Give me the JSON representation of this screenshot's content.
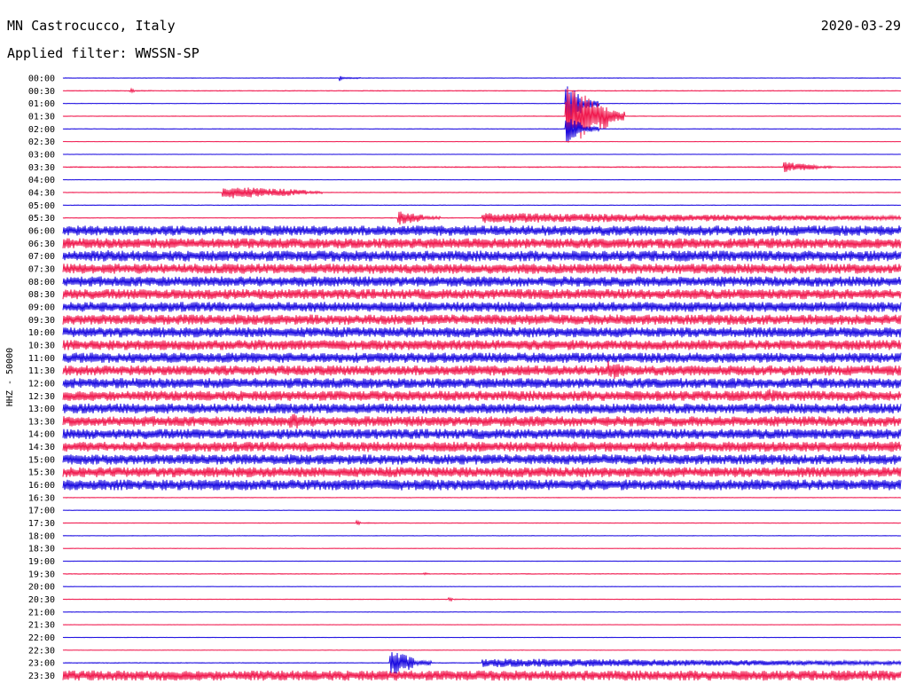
{
  "header": {
    "station": "MN Castrocucco, Italy",
    "date": "2020-03-29",
    "filter": "Applied filter: WWSSN-SP"
  },
  "chart_data": {
    "type": "line",
    "title": "MN Castrocucco, Italy",
    "ylabel": "HHZ - 50000",
    "colors": [
      "#1a0ae0",
      "#f0194e"
    ],
    "rows": [
      {
        "label": "00:00",
        "amp": 0.05,
        "events": [
          {
            "at": 0.33,
            "amp": 0.5,
            "len": 0.005
          }
        ]
      },
      {
        "label": "00:30",
        "amp": 0.06,
        "events": [
          {
            "at": 0.08,
            "amp": 0.4,
            "len": 0.005
          }
        ]
      },
      {
        "label": "01:00",
        "amp": 0.04,
        "events": [
          {
            "at": 0.6,
            "amp": 3.5,
            "len": 0.02
          }
        ]
      },
      {
        "label": "01:30",
        "amp": 0.05,
        "events": [
          {
            "at": 0.6,
            "amp": 4.5,
            "len": 0.05
          }
        ]
      },
      {
        "label": "02:00",
        "amp": 0.05,
        "events": [
          {
            "at": 0.6,
            "amp": 2.2,
            "len": 0.02
          }
        ]
      },
      {
        "label": "02:30",
        "amp": 0.03,
        "events": []
      },
      {
        "label": "03:00",
        "amp": 0.03,
        "events": []
      },
      {
        "label": "03:30",
        "amp": 0.08,
        "events": [
          {
            "at": 0.86,
            "amp": 0.8,
            "len": 0.04
          }
        ]
      },
      {
        "label": "04:00",
        "amp": 0.03,
        "events": []
      },
      {
        "label": "04:30",
        "amp": 0.05,
        "events": [
          {
            "at": 0.19,
            "amp": 1.0,
            "len": 0.1
          }
        ]
      },
      {
        "label": "05:00",
        "amp": 0.05,
        "events": []
      },
      {
        "label": "05:30",
        "amp": 0.06,
        "events": [
          {
            "at": 0.4,
            "amp": 1.2,
            "len": 0.03
          },
          {
            "at": 0.5,
            "amp": 0.8,
            "len": 0.5
          }
        ]
      },
      {
        "label": "06:00",
        "amp": 0.8,
        "events": []
      },
      {
        "label": "06:30",
        "amp": 0.8,
        "events": []
      },
      {
        "label": "07:00",
        "amp": 0.85,
        "events": [
          {
            "at": 0.05,
            "amp": 1.0,
            "len": 0.04
          }
        ]
      },
      {
        "label": "07:30",
        "amp": 0.8,
        "events": []
      },
      {
        "label": "08:00",
        "amp": 0.8,
        "events": []
      },
      {
        "label": "08:30",
        "amp": 0.8,
        "events": []
      },
      {
        "label": "09:00",
        "amp": 0.8,
        "events": []
      },
      {
        "label": "09:30",
        "amp": 0.8,
        "events": []
      },
      {
        "label": "10:00",
        "amp": 0.8,
        "events": []
      },
      {
        "label": "10:30",
        "amp": 0.8,
        "events": [
          {
            "at": 0.23,
            "amp": 1.0,
            "len": 0.03
          }
        ]
      },
      {
        "label": "11:00",
        "amp": 0.8,
        "events": []
      },
      {
        "label": "11:30",
        "amp": 0.8,
        "events": [
          {
            "at": 0.65,
            "amp": 1.6,
            "len": 0.03
          }
        ]
      },
      {
        "label": "12:00",
        "amp": 0.8,
        "events": []
      },
      {
        "label": "12:30",
        "amp": 0.8,
        "events": [
          {
            "at": 0.84,
            "amp": 1.2,
            "len": 0.02
          }
        ]
      },
      {
        "label": "13:00",
        "amp": 0.8,
        "events": []
      },
      {
        "label": "13:30",
        "amp": 0.8,
        "events": [
          {
            "at": 0.27,
            "amp": 1.3,
            "len": 0.05
          }
        ]
      },
      {
        "label": "14:00",
        "amp": 0.8,
        "events": []
      },
      {
        "label": "14:30",
        "amp": 0.8,
        "events": []
      },
      {
        "label": "15:00",
        "amp": 0.8,
        "events": []
      },
      {
        "label": "15:30",
        "amp": 0.8,
        "events": []
      },
      {
        "label": "16:00",
        "amp": 0.85,
        "events": [
          {
            "at": 0.13,
            "amp": 0.9,
            "len": 0.03
          }
        ]
      },
      {
        "label": "16:30",
        "amp": 0.05,
        "events": []
      },
      {
        "label": "17:00",
        "amp": 0.04,
        "events": []
      },
      {
        "label": "17:30",
        "amp": 0.05,
        "events": [
          {
            "at": 0.35,
            "amp": 0.4,
            "len": 0.005
          }
        ]
      },
      {
        "label": "18:00",
        "amp": 0.04,
        "events": []
      },
      {
        "label": "18:30",
        "amp": 0.04,
        "events": []
      },
      {
        "label": "19:00",
        "amp": 0.04,
        "events": []
      },
      {
        "label": "19:30",
        "amp": 0.06,
        "events": [
          {
            "at": 0.43,
            "amp": 0.3,
            "len": 0.005
          }
        ]
      },
      {
        "label": "20:00",
        "amp": 0.04,
        "events": []
      },
      {
        "label": "20:30",
        "amp": 0.05,
        "events": [
          {
            "at": 0.46,
            "amp": 0.4,
            "len": 0.005
          }
        ]
      },
      {
        "label": "21:00",
        "amp": 0.04,
        "events": []
      },
      {
        "label": "21:30",
        "amp": 0.04,
        "events": []
      },
      {
        "label": "22:00",
        "amp": 0.04,
        "events": []
      },
      {
        "label": "22:30",
        "amp": 0.04,
        "events": []
      },
      {
        "label": "23:00",
        "amp": 0.06,
        "events": [
          {
            "at": 0.39,
            "amp": 2.0,
            "len": 0.03
          },
          {
            "at": 0.5,
            "amp": 0.7,
            "len": 0.5
          }
        ]
      },
      {
        "label": "23:30",
        "amp": 0.8,
        "events": []
      }
    ]
  }
}
